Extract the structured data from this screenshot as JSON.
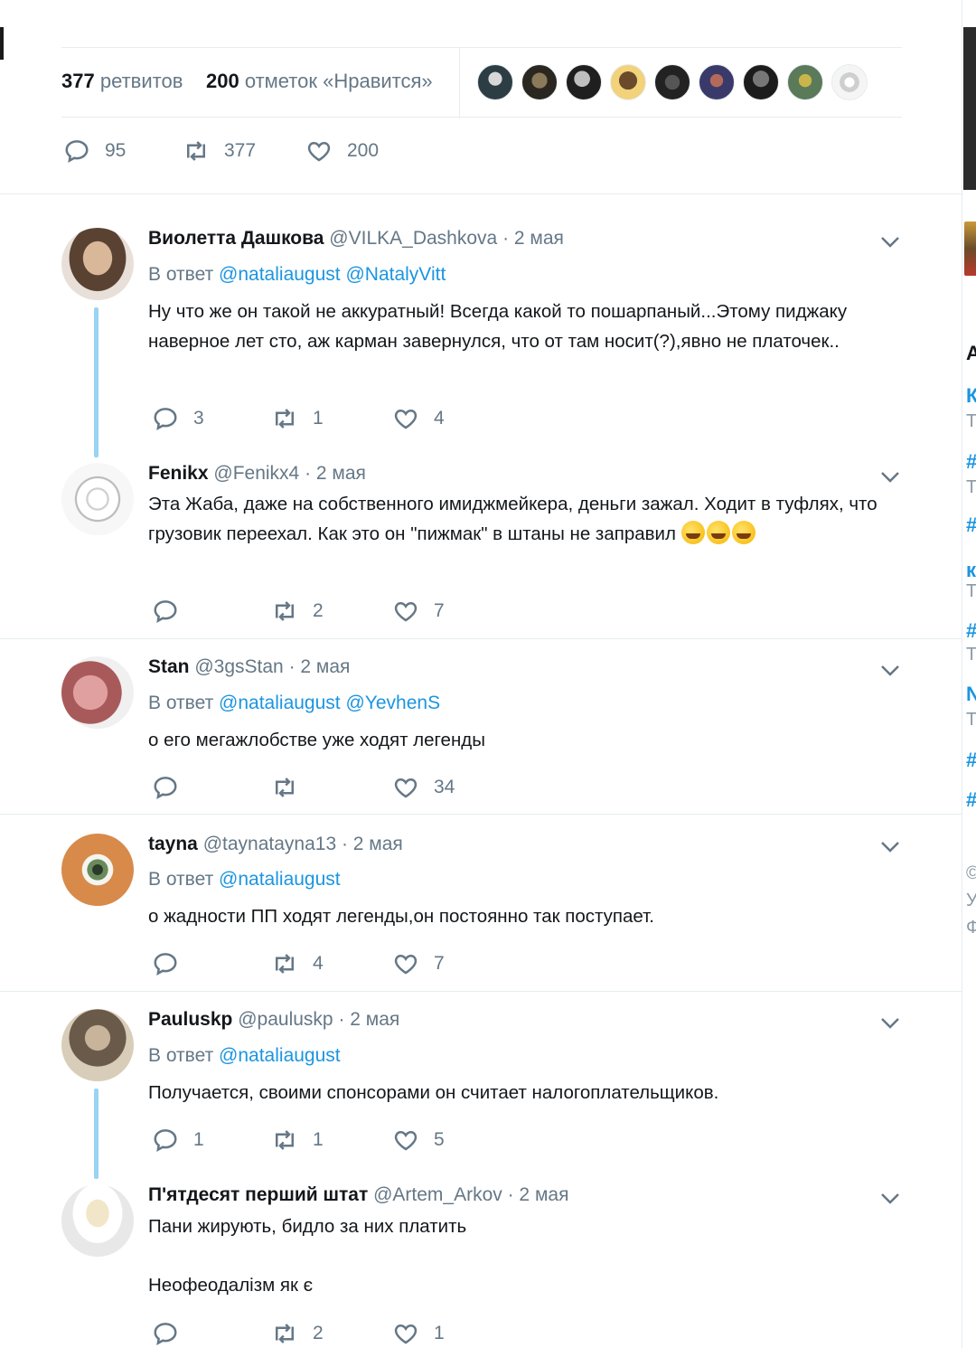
{
  "stats": {
    "retweets_count": "377",
    "retweets_label": "ретвитов",
    "likes_count": "200",
    "likes_label": "отметок «Нравится»",
    "liker_avatars": [
      "avatar-1",
      "avatar-2",
      "avatar-3",
      "avatar-4",
      "avatar-5",
      "avatar-6",
      "avatar-7",
      "avatar-8",
      "avatar-9"
    ]
  },
  "main_actions": {
    "replies": "95",
    "retweets": "377",
    "likes": "200"
  },
  "icons": {
    "reply": "speech-bubble-icon",
    "retweet": "retweet-arrows-icon",
    "like": "heart-icon",
    "menu": "chevron-down-icon"
  },
  "colors": {
    "link": "#1b95e0",
    "secondary": "#657786",
    "thread_line": "#9ad4f4",
    "border": "#e6ecf0"
  },
  "right_sidebar_fragments": [
    "А",
    "К",
    "Т",
    "#",
    "Т",
    "#",
    "к",
    "Т",
    "#",
    "Т",
    "N",
    "Т",
    "#",
    "#",
    "©",
    "У",
    "Ф"
  ],
  "tweets": [
    {
      "name": "Виолетта Дашкова",
      "handle": "@VILKA_Dashkova",
      "date": "· 2 мая",
      "reply_prefix": "В ответ",
      "mention1": "@nataliaugust",
      "mention2": "@NatalyVitt",
      "text": "Ну что же он такой не аккуратный! Всегда какой то пошарпаный...Этому пиджаку наверное лет сто, аж карман завернулся, что от там носит(?),явно не платочек..",
      "replies": "3",
      "retweets": "1",
      "likes": "4"
    },
    {
      "name": "Fenikx",
      "handle": "@Fenikx4",
      "date": "· 2 мая",
      "text": "Эта Жаба, даже на собственного имиджмейкера, деньги зажал. Ходит в туфлях, что грузовик переехал. Как это он \"пижмак\" в штаны не заправил",
      "replies": "",
      "retweets": "2",
      "likes": "7"
    },
    {
      "name": "Stan",
      "handle": "@3gsStan",
      "date": "· 2 мая",
      "reply_prefix": "В ответ",
      "mention1": "@nataliaugust",
      "mention2": "@YevhenS",
      "text": "о его мегажлобстве уже ходят легенды",
      "replies": "",
      "retweets": "",
      "likes": "34"
    },
    {
      "name": "tayna",
      "handle": "@taynatayna13",
      "date": "· 2 мая",
      "reply_prefix": "В ответ",
      "mention1": "@nataliaugust",
      "text": "о жадности ПП ходят легенды,он постоянно так поступает.",
      "replies": "",
      "retweets": "4",
      "likes": "7"
    },
    {
      "name": "Pauluskp",
      "handle": "@pauluskp",
      "date": "· 2 мая",
      "reply_prefix": "В ответ",
      "mention1": "@nataliaugust",
      "text": "Получается, своими спонсорами он считает налогоплательщиков.",
      "replies": "1",
      "retweets": "1",
      "likes": "5"
    },
    {
      "name": "П'ятдесят перший штат",
      "handle": "@Artem_Arkov",
      "date": "· 2 мая",
      "text_line1": "Пани жирують, бидло за них платить",
      "text_line2": "Неофеодалізм як є",
      "replies": "",
      "retweets": "2",
      "likes": "1"
    }
  ]
}
